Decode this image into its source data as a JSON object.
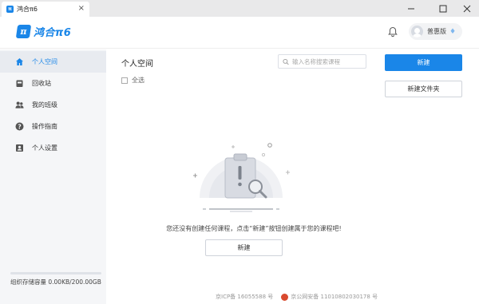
{
  "window": {
    "tab_logo": "π",
    "tab_title": "鸿合π6",
    "tab_close": "×",
    "min": "—",
    "max": "☐",
    "close": "✕"
  },
  "header": {
    "brand_mark": "π",
    "brand_name": "鸿合π6",
    "edition": "普惠版",
    "edition_icon": "♦"
  },
  "sidebar": {
    "items": [
      {
        "label": "个人空间",
        "icon": "home-icon",
        "active": true
      },
      {
        "label": "回收站",
        "icon": "trash-icon"
      },
      {
        "label": "我的班级",
        "icon": "group-icon"
      },
      {
        "label": "操作指南",
        "icon": "help-icon"
      },
      {
        "label": "个人设置",
        "icon": "profile-card-icon"
      }
    ],
    "storage": {
      "label": "组织存储容量 0.00KB/200.00GB",
      "used_fraction": 0.0
    }
  },
  "main": {
    "title": "个人空间",
    "select_all": "全选",
    "search_placeholder": "输入名称搜索课程",
    "new_button": "新建",
    "new_folder_button": "新建文件夹",
    "empty_message": "您还没有创建任何课程，点击“新建”按钮创建属于您的课程吧!",
    "empty_new_button": "新建"
  },
  "footer": {
    "icp": "京ICP备 16055588 号",
    "police": "京公网安备 11010802030178 号"
  },
  "colors": {
    "accent": "#1a86e8",
    "sidebar_bg": "#f5f6f8",
    "titlebar_bg": "#e9e9ea"
  }
}
